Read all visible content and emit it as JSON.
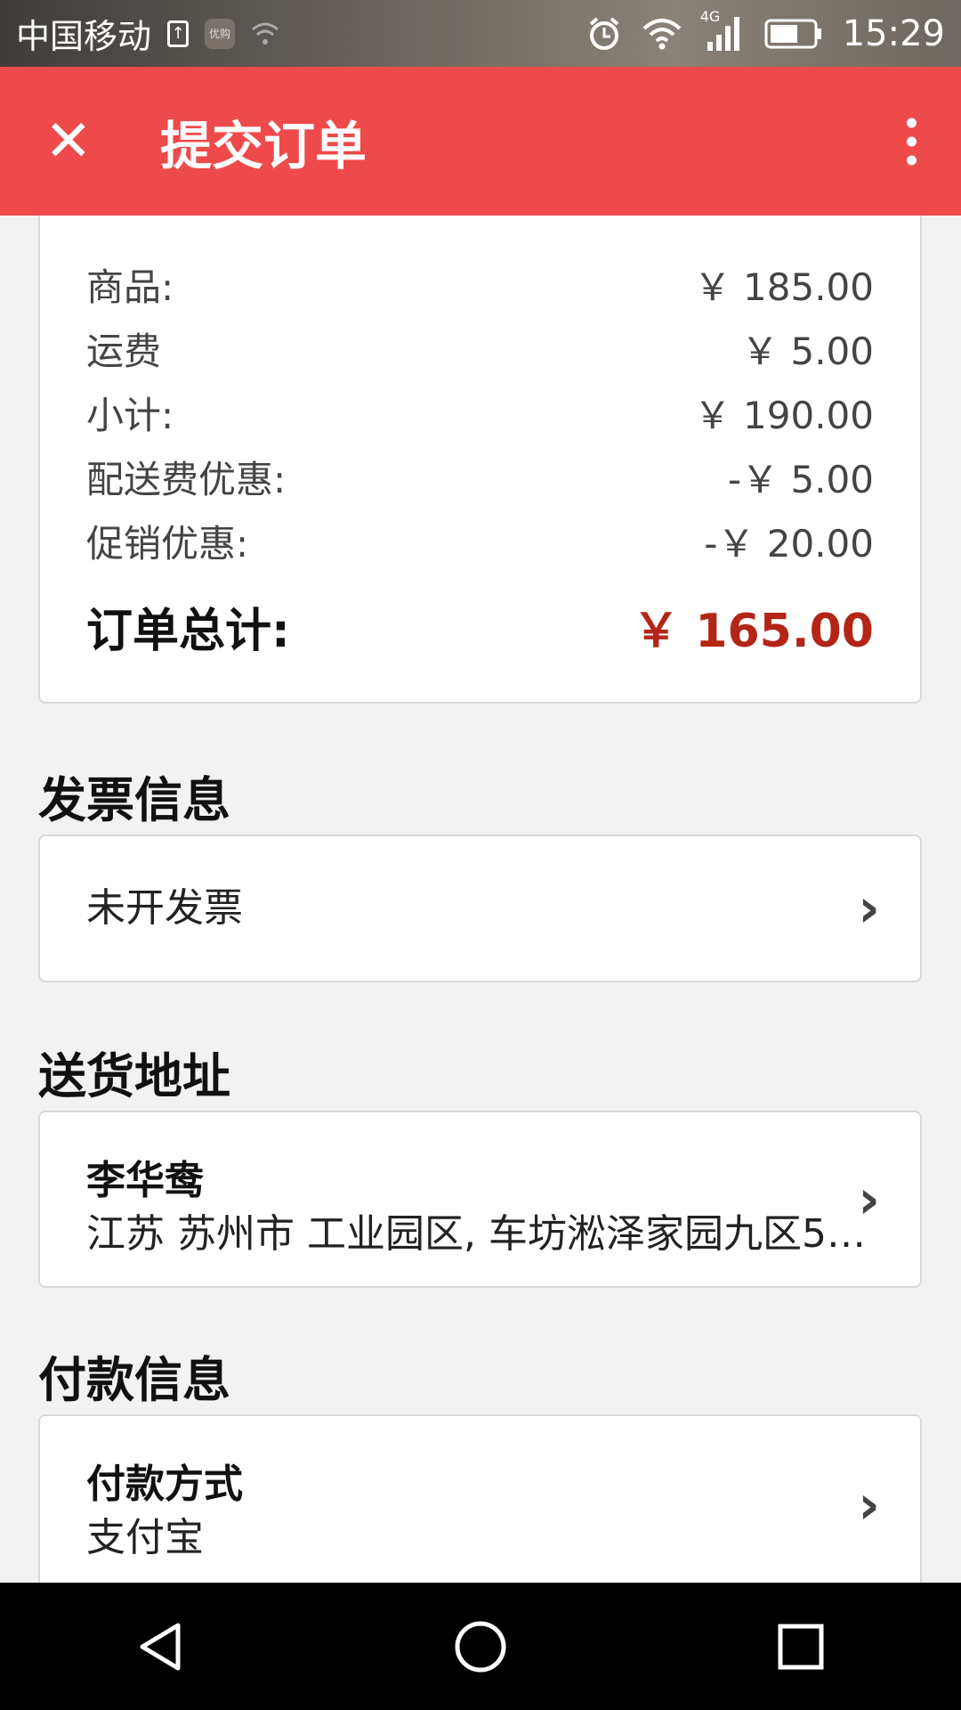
{
  "status_bar": {
    "carrier": "中国移动",
    "app_icon_text": "优购",
    "network": "4G",
    "time": "15:29"
  },
  "app_bar": {
    "title": "提交订单",
    "close_icon": "close-icon",
    "more_icon": "more-vert-icon",
    "color": "#ef4a4b"
  },
  "summary": {
    "rows": [
      {
        "label": "商品:",
        "value": "￥ 185.00"
      },
      {
        "label": "运费",
        "value": "￥ 5.00"
      },
      {
        "label": "小计:",
        "value": "￥ 190.00"
      },
      {
        "label": "配送费优惠:",
        "value": "-￥ 5.00"
      },
      {
        "label": "促销优惠:",
        "value": "-￥ 20.00"
      }
    ],
    "total_label": "订单总计:",
    "total_value": "￥ 165.00",
    "total_color": "#b32516"
  },
  "invoice": {
    "title": "发票信息",
    "value": "未开发票"
  },
  "address": {
    "title": "送货地址",
    "name": "李华鸯",
    "detail": "江苏 苏州市 工业园区, 车坊淞泽家园九区51..."
  },
  "payment": {
    "title": "付款信息",
    "method_label": "付款方式",
    "method_value": "支付宝"
  },
  "nav_bar": {
    "icons": [
      "back-icon",
      "home-icon",
      "recents-icon"
    ]
  }
}
